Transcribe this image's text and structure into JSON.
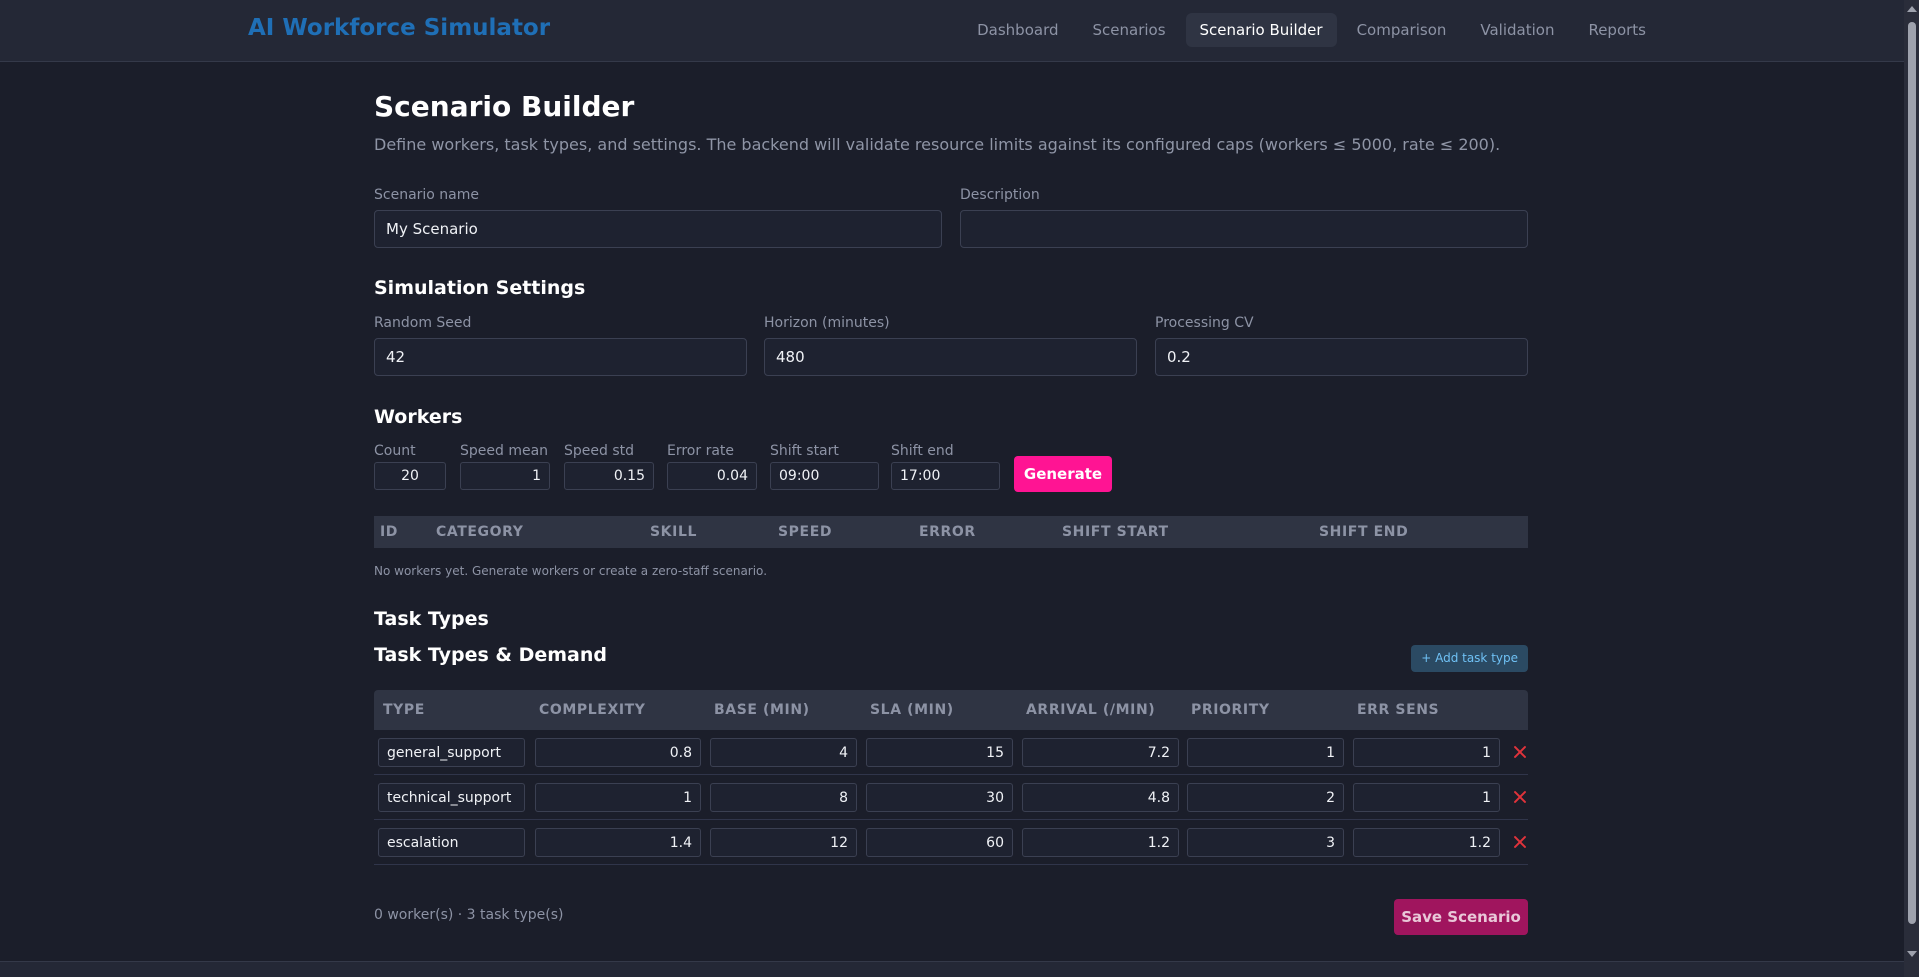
{
  "app": {
    "title": "AI Workforce Simulator",
    "nav": [
      "Dashboard",
      "Scenarios",
      "Scenario Builder",
      "Comparison",
      "Validation",
      "Reports"
    ],
    "active_nav": "Scenario Builder"
  },
  "page": {
    "title": "Scenario Builder",
    "description": "Define workers, task types, and settings. The backend will validate resource limits against its configured caps (workers ≤ 5000, rate ≤ 200)."
  },
  "scenario": {
    "name_label": "Scenario name",
    "name_value": "My Scenario",
    "description_label": "Description",
    "description_value": ""
  },
  "simulation": {
    "title": "Simulation Settings",
    "seed_label": "Random Seed",
    "seed_value": "42",
    "horizon_label": "Horizon (minutes)",
    "horizon_value": "480",
    "cv_label": "Processing CV",
    "cv_value": "0.2"
  },
  "workers": {
    "title": "Workers",
    "count_label": "Count",
    "count_value": "20",
    "speed_mean_label": "Speed mean",
    "speed_mean_value": "1",
    "speed_std_label": "Speed std",
    "speed_std_value": "0.15",
    "error_rate_label": "Error rate",
    "error_rate_value": "0.04",
    "shift_start_label": "Shift start",
    "shift_start_value": "09:00",
    "shift_end_label": "Shift end",
    "shift_end_value": "17:00",
    "generate_label": "Generate",
    "columns": [
      "ID",
      "CATEGORY",
      "SKILL",
      "SPEED",
      "ERROR",
      "SHIFT START",
      "SHIFT END"
    ],
    "empty_note": "No workers yet. Generate workers or create a zero-staff scenario."
  },
  "tasks": {
    "section_title": "Task Types",
    "subtitle": "Task Types & Demand",
    "add_label": "+ Add task type",
    "columns": [
      "TYPE",
      "COMPLEXITY",
      "BASE (MIN)",
      "SLA (MIN)",
      "ARRIVAL (/MIN)",
      "PRIORITY",
      "ERR SENS"
    ],
    "rows": [
      {
        "type": "general_support",
        "complexity": "0.8",
        "base": "4",
        "sla": "15",
        "arrival": "7.2",
        "priority": "1",
        "err_sens": "1"
      },
      {
        "type": "technical_support",
        "complexity": "1",
        "base": "8",
        "sla": "30",
        "arrival": "4.8",
        "priority": "2",
        "err_sens": "1"
      },
      {
        "type": "escalation",
        "complexity": "1.4",
        "base": "12",
        "sla": "60",
        "arrival": "1.2",
        "priority": "3",
        "err_sens": "1.2"
      }
    ]
  },
  "footer": {
    "summary": "0 worker(s) · 3 task type(s)",
    "save_label": "Save Scenario"
  }
}
